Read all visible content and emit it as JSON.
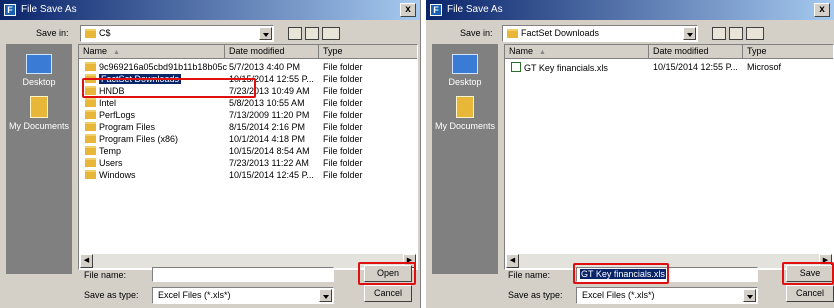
{
  "dialog1": {
    "title": "File Save As",
    "app_icon_letter": "F",
    "close_glyph": "x",
    "save_in_label": "Save in:",
    "save_in_value": "C$",
    "columns": [
      "Name",
      "Date modified",
      "Type"
    ],
    "rows": [
      {
        "name": "9c969216a05cbd91b11b18b05c",
        "date": "5/7/2013 4:40 PM",
        "type": "File folder"
      },
      {
        "name": "FactSet Downloads",
        "date": "10/15/2014 12:55 P...",
        "type": "File folder",
        "selected": true
      },
      {
        "name": "HNDB",
        "date": "7/23/2013 10:49 AM",
        "type": "File folder"
      },
      {
        "name": "Intel",
        "date": "5/8/2013 10:55 AM",
        "type": "File folder"
      },
      {
        "name": "PerfLogs",
        "date": "7/13/2009 11:20 PM",
        "type": "File folder"
      },
      {
        "name": "Program Files",
        "date": "8/15/2014 2:16 PM",
        "type": "File folder"
      },
      {
        "name": "Program Files (x86)",
        "date": "10/1/2014 4:18 PM",
        "type": "File folder"
      },
      {
        "name": "Temp",
        "date": "10/15/2014 8:54 AM",
        "type": "File folder"
      },
      {
        "name": "Users",
        "date": "7/23/2013 11:22 AM",
        "type": "File folder"
      },
      {
        "name": "Windows",
        "date": "10/15/2014 12:45 P...",
        "type": "File folder"
      }
    ],
    "places": [
      "Desktop",
      "My Documents"
    ],
    "file_name_label": "File name:",
    "file_name_value": "",
    "save_as_type_label": "Save as type:",
    "save_as_type_value": "Excel Files (*.xls*)",
    "primary_button": "Open",
    "cancel_button": "Cancel"
  },
  "dialog2": {
    "title": "File Save As",
    "app_icon_letter": "F",
    "close_glyph": "x",
    "save_in_label": "Save in:",
    "save_in_value": "FactSet Downloads",
    "columns": [
      "Name",
      "Date modified",
      "Type"
    ],
    "rows": [
      {
        "name": "GT Key financials.xls",
        "date": "10/15/2014 12:55 P...",
        "type": "Microsof"
      }
    ],
    "places": [
      "Desktop",
      "My Documents"
    ],
    "file_name_label": "File name:",
    "file_name_value": "GT Key financials.xls",
    "save_as_type_label": "Save as type:",
    "save_as_type_value": "Excel Files (*.xls*)",
    "primary_button": "Save",
    "cancel_button": "Cancel"
  },
  "colors": {
    "highlight": "#e01010",
    "title_bar": "#0a246a",
    "selection": "#0a246a"
  }
}
